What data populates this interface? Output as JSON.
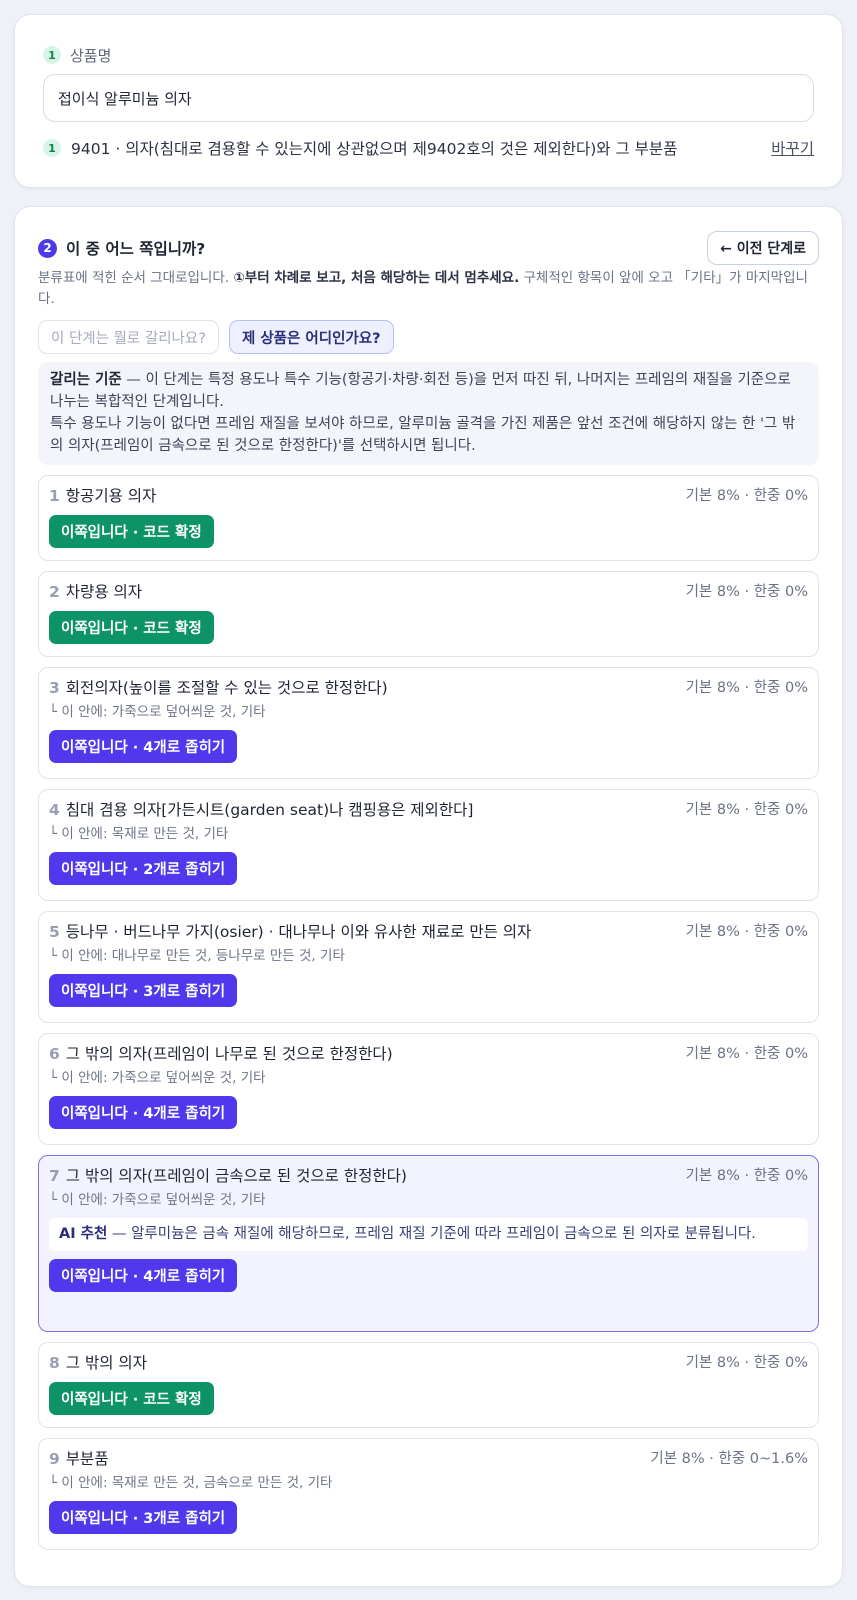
{
  "product": {
    "step_badge": "1",
    "label": "상품명",
    "value": "접이식 알루미늄 의자"
  },
  "heading": {
    "step_badge": "1",
    "code": "9401",
    "separator": " · ",
    "text": "의자(침대로 겸용할 수 있는지에 상관없으며 제9402호의 것은 제외한다)와 그 부분품",
    "change_label": "바꾸기"
  },
  "question": {
    "step_badge": "2",
    "title": "이 중 어느 쪽입니까?",
    "prev_label": "← 이전 단계로",
    "desc_pre": "분류표에 적힌 순서 그대로입니다. ",
    "desc_bold": "①부터 차례로 보고, 처음 해당하는 데서 멈추세요.",
    "desc_post": " 구체적인 항목이 앞에 오고 「기타」가 마지막입니다.",
    "pill_why": "이 단계는 뭘로 갈리나요?",
    "pill_mine": "제 상품은 어디인가요?"
  },
  "criteria": {
    "label": "갈리는 기준",
    "text1": " — 이 단계는 특정 용도나 특수 기능(항공기·차량·회전 등)을 먼저 따진 뒤, 나머지는 프레임의 재질을 기준으로 나누는 복합적인 단계입니다.",
    "text2": "특수 용도나 기능이 없다면 프레임 재질을 보셔야 하므로, 알루미늄 골격을 가진 제품은 앞선 조건에 해당하지 않는 한 '그 밖의 의자(프레임이 금속으로 된 것으로 한정한다)'를 선택하시면 됩니다."
  },
  "options": [
    {
      "num": "1",
      "title": "항공기용 의자",
      "rate": "기본 8% · 한중 0%",
      "sub": "",
      "button": "이쪽입니다 · 코드 확정"
    },
    {
      "num": "2",
      "title": "차량용 의자",
      "rate": "기본 8% · 한중 0%",
      "sub": "",
      "button": "이쪽입니다 · 코드 확정"
    },
    {
      "num": "3",
      "title": "회전의자(높이를 조절할 수 있는 것으로 한정한다)",
      "rate": "기본 8% · 한중 0%",
      "sub": "└ 이 안에: 가죽으로 덮어씌운 것, 기타",
      "button": "이쪽입니다 · 4개로 좁히기"
    },
    {
      "num": "4",
      "title": "침대 겸용 의자[가든시트(garden seat)나 캠핑용은 제외한다]",
      "rate": "기본 8% · 한중 0%",
      "sub": "└ 이 안에: 목재로 만든 것, 기타",
      "button": "이쪽입니다 · 2개로 좁히기"
    },
    {
      "num": "5",
      "title": "등나무 · 버드나무 가지(osier) · 대나무나 이와 유사한 재료로 만든 의자",
      "rate": "기본 8% · 한중 0%",
      "sub": "└ 이 안에: 대나무로 만든 것, 등나무로 만든 것, 기타",
      "button": "이쪽입니다 · 3개로 좁히기"
    },
    {
      "num": "6",
      "title": "그 밖의 의자(프레임이 나무로 된 것으로 한정한다)",
      "rate": "기본 8% · 한중 0%",
      "sub": "└ 이 안에: 가죽으로 덮어씌운 것, 기타",
      "button": "이쪽입니다 · 4개로 좁히기"
    },
    {
      "num": "7",
      "title": "그 밖의 의자(프레임이 금속으로 된 것으로 한정한다)",
      "rate": "기본 8% · 한중 0%",
      "sub": "└ 이 안에: 가죽으로 덮어씌운 것, 기타",
      "ai_label": "AI 추천",
      "ai_text": " — 알루미늄은 금속 재질에 해당하므로, 프레임 재질 기준에 따라 프레임이 금속으로 된 의자로 분류됩니다.",
      "button": "이쪽입니다 · 4개로 좁히기"
    },
    {
      "num": "8",
      "title": "그 밖의 의자",
      "rate": "기본 8% · 한중 0%",
      "sub": "",
      "button": "이쪽입니다 · 코드 확정"
    },
    {
      "num": "9",
      "title": "부분품",
      "rate": "기본 8% · 한중 0~1.6%",
      "sub": "└ 이 안에: 목재로 만든 것, 금속으로 만든 것, 기타",
      "button": "이쪽입니다 · 3개로 좁히기"
    }
  ],
  "colors": {
    "confirm_button": "#0e9366",
    "narrow_button": "#5238ec",
    "highlight_border": "#7d72ea"
  }
}
